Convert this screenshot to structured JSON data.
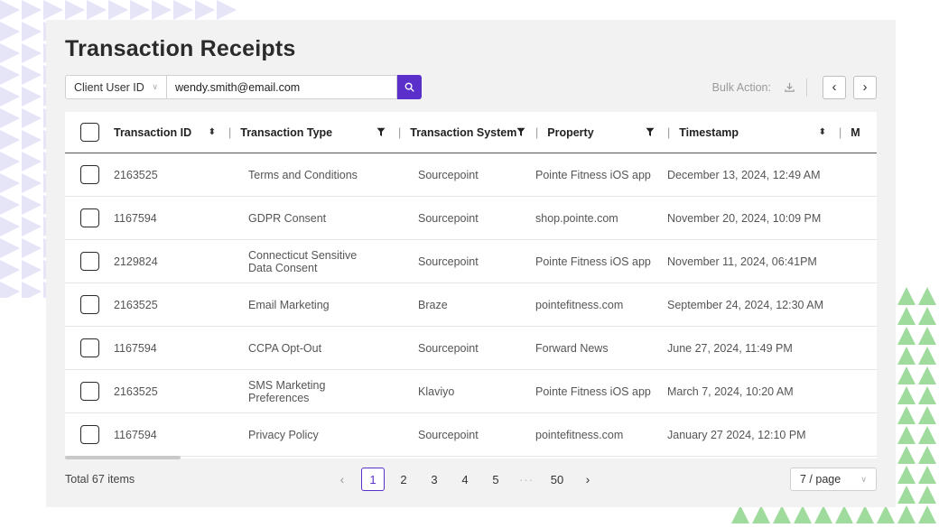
{
  "page": {
    "title": "Transaction Receipts"
  },
  "search": {
    "field_label": "Client User ID",
    "value": "wendy.smith@email.com"
  },
  "bulk": {
    "label": "Bulk Action:"
  },
  "table": {
    "columns": [
      {
        "label": "Transaction ID",
        "control": "sort"
      },
      {
        "label": "Transaction Type",
        "control": "filter"
      },
      {
        "label": "Transaction System",
        "control": "filter"
      },
      {
        "label": "Property",
        "control": "filter"
      },
      {
        "label": "Timestamp",
        "control": "sort"
      },
      {
        "label": "M",
        "control": "none"
      }
    ],
    "rows": [
      {
        "id": "2163525",
        "type": "Terms and Conditions",
        "system": "Sourcepoint",
        "property": "Pointe Fitness iOS app",
        "timestamp": "December 13, 2024, 12:49 AM"
      },
      {
        "id": "1167594",
        "type": "GDPR Consent",
        "system": "Sourcepoint",
        "property": "shop.pointe.com",
        "timestamp": "November 20, 2024, 10:09 PM"
      },
      {
        "id": "2129824",
        "type": "Connecticut Sensitive Data Consent",
        "system": "Sourcepoint",
        "property": "Pointe Fitness iOS app",
        "timestamp": "November 11, 2024, 06:41PM"
      },
      {
        "id": "2163525",
        "type": "Email Marketing",
        "system": "Braze",
        "property": "pointefitness.com",
        "timestamp": "September 24, 2024, 12:30 AM"
      },
      {
        "id": "1167594",
        "type": "CCPA Opt-Out",
        "system": "Sourcepoint",
        "property": "Forward News",
        "timestamp": "June 27, 2024, 11:49 PM"
      },
      {
        "id": "2163525",
        "type": "SMS Marketing Preferences",
        "system": "Klaviyo",
        "property": "Pointe Fitness iOS app",
        "timestamp": "March 7, 2024, 10:20 AM"
      },
      {
        "id": "1167594",
        "type": "Privacy Policy",
        "system": "Sourcepoint",
        "property": "pointefitness.com",
        "timestamp": "January 27 2024, 12:10 PM"
      }
    ]
  },
  "footer": {
    "total": "Total 67 items",
    "pages": [
      "1",
      "2",
      "3",
      "4",
      "5"
    ],
    "ellipsis": "···",
    "last_page": "50",
    "page_size": "7 / page"
  },
  "icons": {
    "search": "search-icon",
    "download": "download-icon",
    "filter": "filter-icon",
    "sort": "sort-icon",
    "prev": "chevron-left-icon",
    "next": "chevron-right-icon",
    "dropdown": "chevron-down-icon"
  },
  "colors": {
    "accent": "#5b2fc9",
    "deco_left": "#e3e1f6",
    "deco_right": "#9bd99a"
  }
}
